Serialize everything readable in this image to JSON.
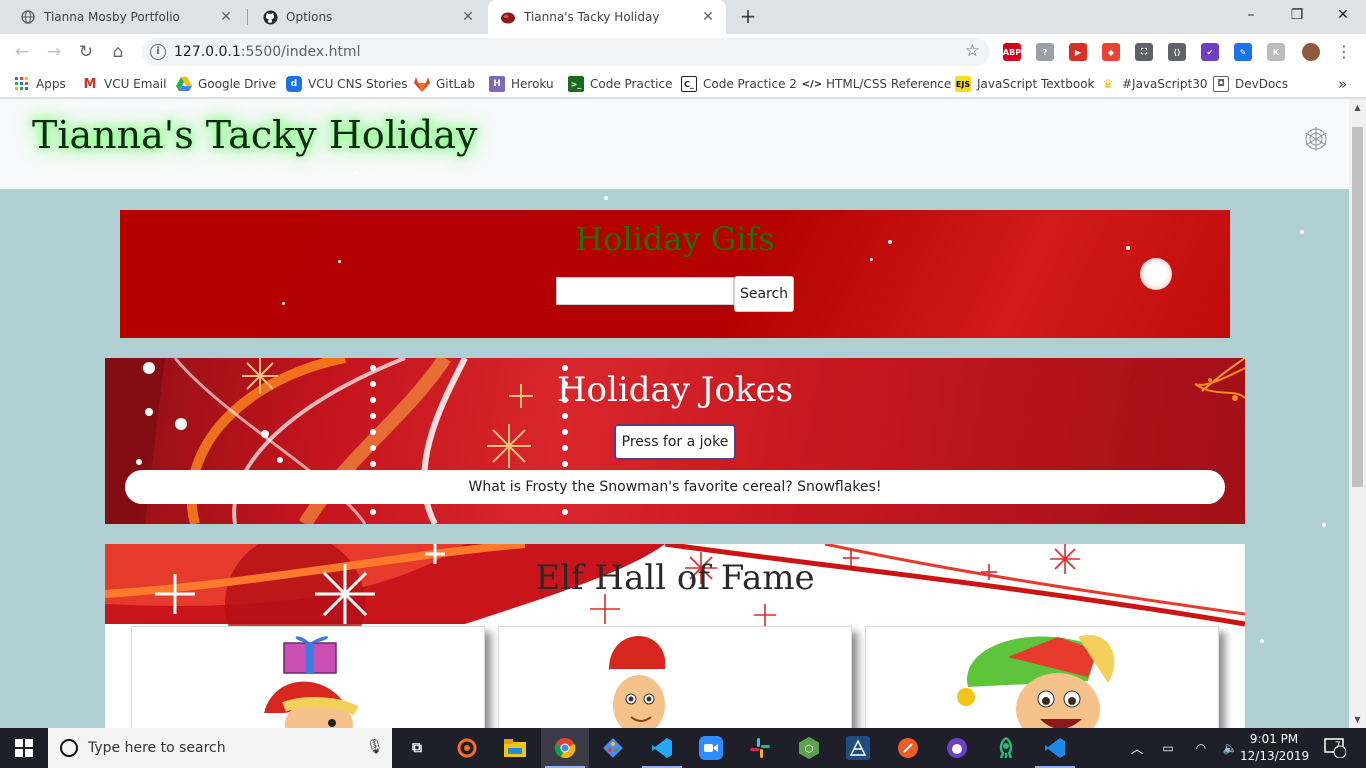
{
  "browser": {
    "tabs": [
      {
        "title": "Tianna Mosby Portfolio",
        "favicon": "globe-icon"
      },
      {
        "title": "Options",
        "favicon": "github-icon"
      },
      {
        "title": "Tianna's Tacky Holiday",
        "favicon": "ornament-icon",
        "active": true
      }
    ],
    "new_tab_label": "+",
    "window_controls": {
      "minimize": "–",
      "restore": "❐",
      "close": "✕"
    },
    "url_host": "127.0.0.1",
    "url_rest": ":5500/index.html",
    "bookmarks": [
      {
        "label": "Apps",
        "icon": "apps-grid-icon"
      },
      {
        "label": "VCU Email",
        "icon": "gmail-icon"
      },
      {
        "label": "Google Drive",
        "icon": "google-drive-icon"
      },
      {
        "label": "VCU CNS Stories",
        "icon": "d-logo-icon"
      },
      {
        "label": "GitLab",
        "icon": "gitlab-icon"
      },
      {
        "label": "Heroku",
        "icon": "heroku-icon"
      },
      {
        "label": "Code Practice",
        "icon": "code-practice-icon"
      },
      {
        "label": "Code Practice 2",
        "icon": "code-practice-2-icon"
      },
      {
        "label": "HTML/CSS Reference",
        "icon": "code-brackets-icon"
      },
      {
        "label": "JavaScript Textbook",
        "icon": "ejs-icon"
      },
      {
        "label": "#JavaScript30",
        "icon": "crown-icon"
      },
      {
        "label": "DevDocs",
        "icon": "devdocs-icon"
      }
    ],
    "bookmarks_overflow": "»",
    "extensions": [
      {
        "name": "adblock-plus-icon",
        "text": "ABP",
        "color": "#d6001c"
      },
      {
        "name": "help-icon",
        "text": "?",
        "color": "#9aa0a6"
      },
      {
        "name": "media-extension-icon",
        "text": "▶",
        "color": "#d93025"
      },
      {
        "name": "cast-extension-icon",
        "text": "◆",
        "color": "#ea4335"
      },
      {
        "name": "screenshot-extension-icon",
        "text": "⛶",
        "color": "#5f6368"
      },
      {
        "name": "code-extension-icon",
        "text": "⟨⟩",
        "color": "#5f6368"
      },
      {
        "name": "check-extension-icon",
        "text": "✔",
        "color": "#6f3fc2"
      },
      {
        "name": "eyedropper-extension-icon",
        "text": "✎",
        "color": "#1a73e8"
      },
      {
        "name": "k-extension-icon",
        "text": "K",
        "color": "#bdbdbd"
      }
    ]
  },
  "site": {
    "title": "Tianna's Tacky Holiday",
    "settings_icon": "snowflake-gear-icon",
    "gifs": {
      "heading": "Holiday Gifs",
      "search_value": "",
      "search_button": "Search"
    },
    "jokes": {
      "heading": "Holiday Jokes",
      "button": "Press for a joke",
      "joke": "What is Frosty the Snowman's favorite cereal? Snowflakes!"
    },
    "elves": {
      "heading": "Elf Hall of Fame",
      "cards": [
        {
          "image": "elf-with-gift-icon"
        },
        {
          "image": "elf-in-santa-hat-icon"
        },
        {
          "image": "elf-in-green-hat-icon"
        }
      ]
    }
  },
  "taskbar": {
    "search_placeholder": "Type here to search",
    "time": "9:01 PM",
    "date": "12/13/2019",
    "notifications": "7",
    "apps": [
      "task-view-icon",
      "origin-icon",
      "file-explorer-icon",
      "chrome-icon",
      "sourcetree-icon",
      "vscode-icon",
      "zoom-icon",
      "slack-icon",
      "node-icon",
      "wireframe-icon",
      "postman-icon",
      "github-desktop-icon",
      "gitkraken-icon",
      "vscode-insiders-icon"
    ]
  },
  "colors": {
    "page_background": "#b0cfd3",
    "gifs_heading": "#1f6f14",
    "title_glow": "#6cff6c"
  }
}
